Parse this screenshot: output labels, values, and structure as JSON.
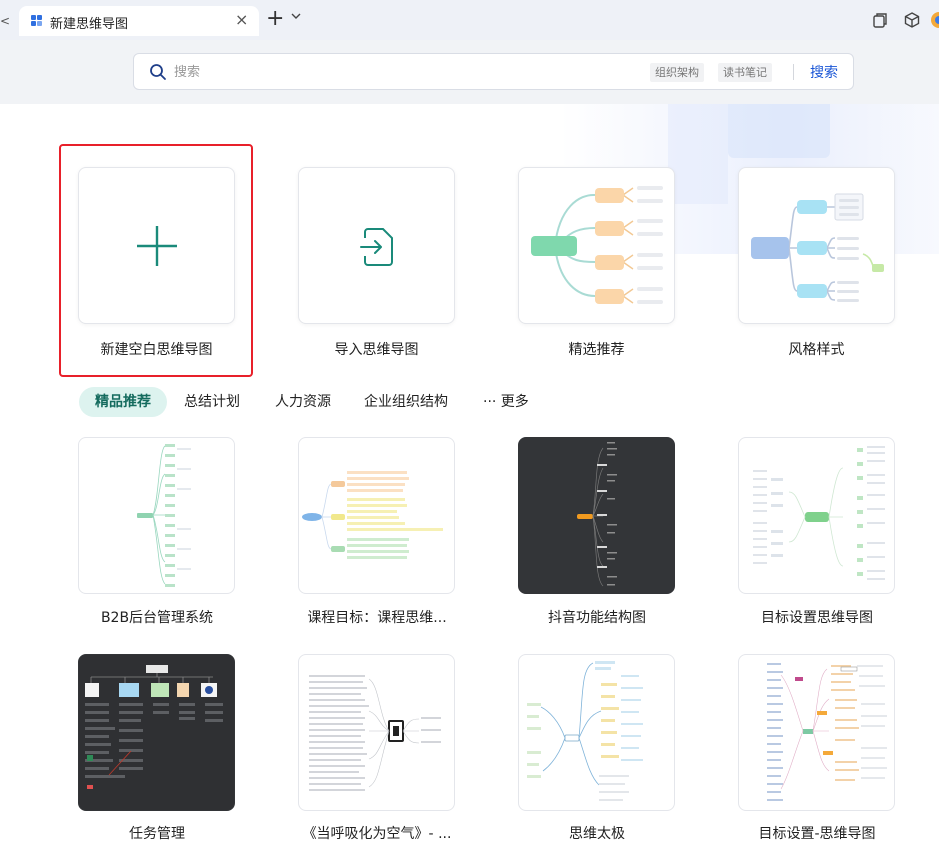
{
  "browser": {
    "tab_title": "新建思维导图",
    "tab_close": "×",
    "new_tab": "+",
    "tab_dropdown": "⌄",
    "prev_arrow": "<"
  },
  "search": {
    "placeholder": "搜索",
    "value": "",
    "chips": [
      "组织架构",
      "读书笔记"
    ],
    "button": "搜索"
  },
  "actions": [
    {
      "label": "新建空白思维导图"
    },
    {
      "label": "导入思维导图"
    },
    {
      "label": "精选推荐"
    },
    {
      "label": "风格样式"
    }
  ],
  "categories": {
    "active": "精品推荐",
    "items": [
      "总结计划",
      "人力资源",
      "企业组织结构"
    ],
    "more": "··· 更多"
  },
  "templates": [
    {
      "label": "B2B后台管理系统"
    },
    {
      "label": "课程目标：课程思维..."
    },
    {
      "label": "抖音功能结构图"
    },
    {
      "label": "目标设置思维导图"
    },
    {
      "label": "任务管理"
    },
    {
      "label": "《当呼吸化为空气》- ..."
    },
    {
      "label": "思维太极"
    },
    {
      "label": "目标设置-思维导图"
    }
  ],
  "thumbnail_text": {
    "root_b2b": "B2B",
    "root_course": "课程目标",
    "root_douyin": "抖音",
    "root_goal": "目标设置",
    "root_task": "任务管理",
    "root_taiji": "思维太极"
  },
  "colors": {
    "accent_green": "#1a8a7a",
    "search_blue": "#1a56d6",
    "highlight_red": "#e8202a",
    "active_tab_bg": "#ddf3ef"
  }
}
